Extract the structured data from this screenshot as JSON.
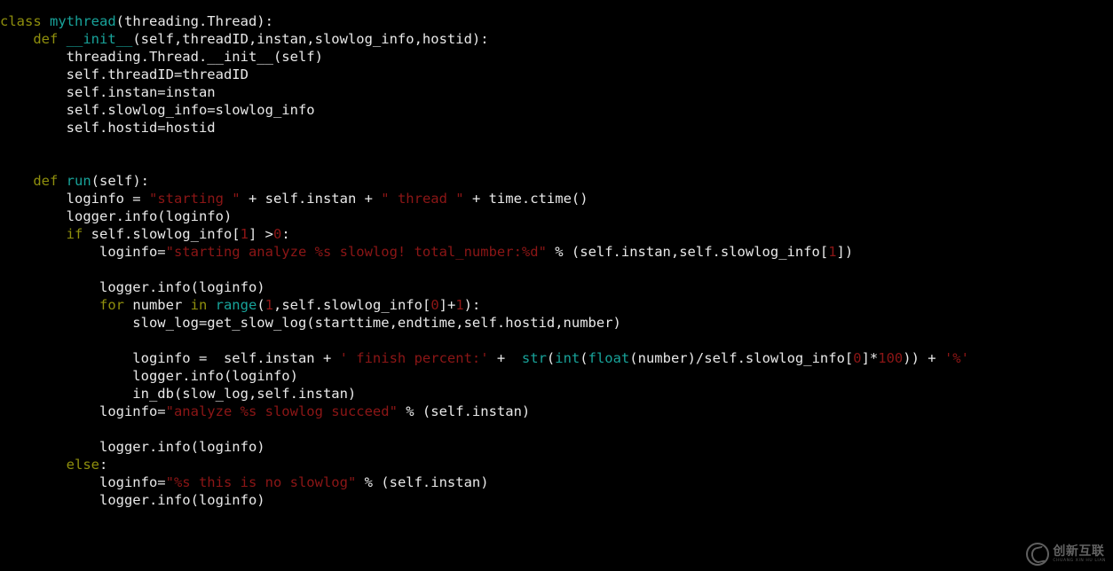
{
  "editor": {
    "background_color": "#000000",
    "default_text_color": "#e9e9e9",
    "language": "python",
    "font_size_px": 15.5,
    "line_height_px": 20,
    "total_lines": 29
  },
  "palette": {
    "keyword": "#8f8f0d",
    "function_name": "#18a39a",
    "builtin": "#18a39a",
    "string": "#8c1616",
    "number": "#8c1616",
    "plain": "#e9e9e9"
  },
  "code": {
    "lines": [
      [
        {
          "t": "class ",
          "c": "keyword"
        },
        {
          "t": "mythread",
          "c": "function_name"
        },
        {
          "t": "(threading.Thread):",
          "c": "plain"
        }
      ],
      [
        {
          "t": "    ",
          "c": "plain"
        },
        {
          "t": "def ",
          "c": "keyword"
        },
        {
          "t": "__init__",
          "c": "function_name"
        },
        {
          "t": "(self,threadID,instan,slowlog_info,hostid):",
          "c": "plain"
        }
      ],
      [
        {
          "t": "        threading.Thread.__init__(self)",
          "c": "plain"
        }
      ],
      [
        {
          "t": "        self.threadID=threadID",
          "c": "plain"
        }
      ],
      [
        {
          "t": "        self.instan=instan",
          "c": "plain"
        }
      ],
      [
        {
          "t": "        self.slowlog_info=slowlog_info",
          "c": "plain"
        }
      ],
      [
        {
          "t": "        self.hostid=hostid",
          "c": "plain"
        }
      ],
      [
        {
          "t": "",
          "c": "plain"
        }
      ],
      [
        {
          "t": "",
          "c": "plain"
        }
      ],
      [
        {
          "t": "    ",
          "c": "plain"
        },
        {
          "t": "def ",
          "c": "keyword"
        },
        {
          "t": "run",
          "c": "function_name"
        },
        {
          "t": "(self):",
          "c": "plain"
        }
      ],
      [
        {
          "t": "        loginfo = ",
          "c": "plain"
        },
        {
          "t": "\"starting \"",
          "c": "string"
        },
        {
          "t": " + self.instan + ",
          "c": "plain"
        },
        {
          "t": "\" thread \"",
          "c": "string"
        },
        {
          "t": " + time.ctime()",
          "c": "plain"
        }
      ],
      [
        {
          "t": "        logger.info(loginfo)",
          "c": "plain"
        }
      ],
      [
        {
          "t": "        ",
          "c": "plain"
        },
        {
          "t": "if ",
          "c": "keyword"
        },
        {
          "t": "self.slowlog_info[",
          "c": "plain"
        },
        {
          "t": "1",
          "c": "number"
        },
        {
          "t": "] >",
          "c": "plain"
        },
        {
          "t": "0",
          "c": "number"
        },
        {
          "t": ":",
          "c": "plain"
        }
      ],
      [
        {
          "t": "            loginfo=",
          "c": "plain"
        },
        {
          "t": "\"starting analyze %s slowlog! total_number:%d\"",
          "c": "string"
        },
        {
          "t": " % (self.instan,self.slowlog_info[",
          "c": "plain"
        },
        {
          "t": "1",
          "c": "number"
        },
        {
          "t": "])",
          "c": "plain"
        }
      ],
      [
        {
          "t": "",
          "c": "plain"
        }
      ],
      [
        {
          "t": "            logger.info(loginfo)",
          "c": "plain"
        }
      ],
      [
        {
          "t": "            ",
          "c": "plain"
        },
        {
          "t": "for ",
          "c": "keyword"
        },
        {
          "t": "number ",
          "c": "plain"
        },
        {
          "t": "in ",
          "c": "keyword"
        },
        {
          "t": "range",
          "c": "builtin"
        },
        {
          "t": "(",
          "c": "plain"
        },
        {
          "t": "1",
          "c": "number"
        },
        {
          "t": ",self.slowlog_info[",
          "c": "plain"
        },
        {
          "t": "0",
          "c": "number"
        },
        {
          "t": "]+",
          "c": "plain"
        },
        {
          "t": "1",
          "c": "number"
        },
        {
          "t": "):",
          "c": "plain"
        }
      ],
      [
        {
          "t": "                slow_log=get_slow_log(starttime,endtime,self.hostid,number)",
          "c": "plain"
        }
      ],
      [
        {
          "t": "",
          "c": "plain"
        }
      ],
      [
        {
          "t": "                loginfo =  self.instan + ",
          "c": "plain"
        },
        {
          "t": "' finish percent:'",
          "c": "string"
        },
        {
          "t": " +  ",
          "c": "plain"
        },
        {
          "t": "str",
          "c": "builtin"
        },
        {
          "t": "(",
          "c": "plain"
        },
        {
          "t": "int",
          "c": "builtin"
        },
        {
          "t": "(",
          "c": "plain"
        },
        {
          "t": "float",
          "c": "builtin"
        },
        {
          "t": "(number)/self.slowlog_info[",
          "c": "plain"
        },
        {
          "t": "0",
          "c": "number"
        },
        {
          "t": "]*",
          "c": "plain"
        },
        {
          "t": "100",
          "c": "number"
        },
        {
          "t": ")) + ",
          "c": "plain"
        },
        {
          "t": "'%'",
          "c": "string"
        }
      ],
      [
        {
          "t": "                logger.info(loginfo)",
          "c": "plain"
        }
      ],
      [
        {
          "t": "                in_db(slow_log,self.instan)",
          "c": "plain"
        }
      ],
      [
        {
          "t": "            loginfo=",
          "c": "plain"
        },
        {
          "t": "\"analyze %s slowlog succeed\"",
          "c": "string"
        },
        {
          "t": " % (self.instan)",
          "c": "plain"
        }
      ],
      [
        {
          "t": "",
          "c": "plain"
        }
      ],
      [
        {
          "t": "            logger.info(loginfo)",
          "c": "plain"
        }
      ],
      [
        {
          "t": "        ",
          "c": "plain"
        },
        {
          "t": "else",
          "c": "keyword"
        },
        {
          "t": ":",
          "c": "plain"
        }
      ],
      [
        {
          "t": "            loginfo=",
          "c": "plain"
        },
        {
          "t": "\"%s this is no slowlog\"",
          "c": "string"
        },
        {
          "t": " % (self.instan)",
          "c": "plain"
        }
      ],
      [
        {
          "t": "            logger.info(loginfo)",
          "c": "plain"
        }
      ],
      [
        {
          "t": "",
          "c": "plain"
        }
      ]
    ],
    "plain_text": "class mythread(threading.Thread):\n    def __init__(self,threadID,instan,slowlog_info,hostid):\n        threading.Thread.__init__(self)\n        self.threadID=threadID\n        self.instan=instan\n        self.slowlog_info=slowlog_info\n        self.hostid=hostid\n\n\n    def run(self):\n        loginfo = \"starting \" + self.instan + \" thread \" + time.ctime()\n        logger.info(loginfo)\n        if self.slowlog_info[1] >0:\n            loginfo=\"starting analyze %s slowlog! total_number:%d\" % (self.instan,self.slowlog_info[1])\n\n            logger.info(loginfo)\n            for number in range(1,self.slowlog_info[0]+1):\n                slow_log=get_slow_log(starttime,endtime,self.hostid,number)\n\n                loginfo =  self.instan + ' finish percent:' +  str(int(float(number)/self.slowlog_info[0]*100)) + '%'\n                logger.info(loginfo)\n                in_db(slow_log,self.instan)\n            loginfo=\"analyze %s slowlog succeed\" % (self.instan)\n\n            logger.info(loginfo)\n        else:\n            loginfo=\"%s this is no slowlog\" % (self.instan)\n            logger.info(loginfo)\n"
  },
  "watermark": {
    "chinese_text": "创新互联",
    "latin_text": "CHUANG XIN HU LIAN",
    "color": "#9e9e9e"
  }
}
